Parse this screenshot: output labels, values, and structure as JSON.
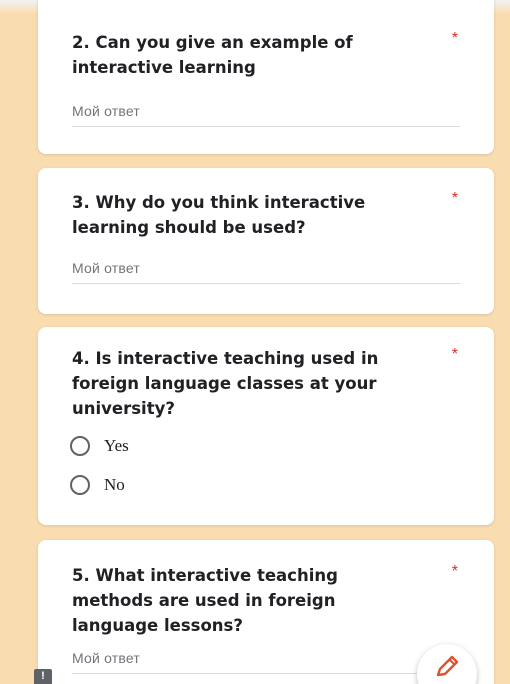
{
  "questions": [
    {
      "title_line1": "2.  Can you give an example of",
      "title_line2": "interactive learning",
      "required_mark": "*",
      "answer_placeholder": "Мой ответ"
    },
    {
      "title_line1": "3.   Why do you think interactive",
      "title_line2": "learning should be used?",
      "required_mark": "*",
      "answer_placeholder": "Мой ответ"
    },
    {
      "title_line1": "4.   Is interactive teaching used in",
      "title_line2": "foreign language classes at your",
      "title_line3": "university?",
      "required_mark": "*",
      "options": [
        "Yes",
        "No"
      ]
    },
    {
      "title_line1": "5.   What interactive teaching",
      "title_line2": "methods are used in foreign",
      "title_line3": "language lessons?",
      "required_mark": "*",
      "answer_placeholder": "Мой ответ"
    }
  ],
  "icons": {
    "fab": "pencil-icon",
    "report": "exclamation-icon"
  },
  "report_label": "!",
  "colors": {
    "background": "#f9ddb1",
    "required": "#d93025",
    "pencil": "#e0522b"
  }
}
